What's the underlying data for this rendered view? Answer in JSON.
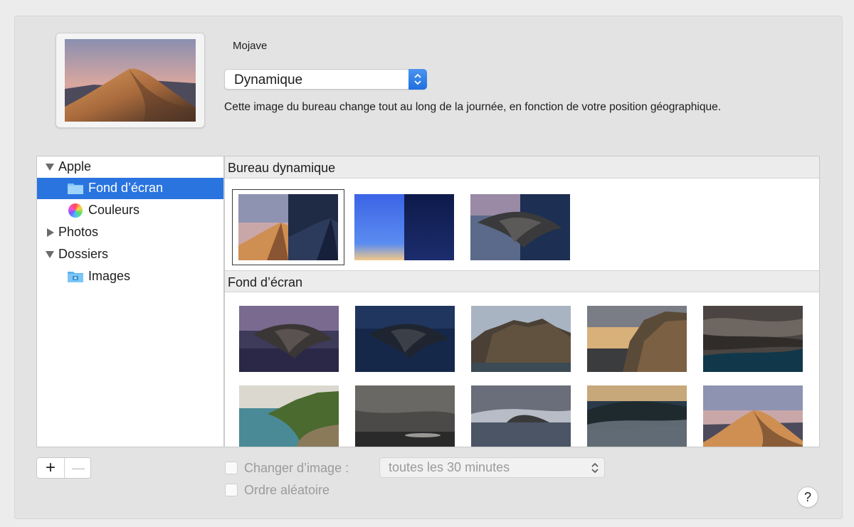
{
  "preview": {
    "wallpaper_name": "Mojave"
  },
  "mode_select": {
    "value": "Dynamique"
  },
  "description": "Cette image du bureau change tout au long de la journée, en fonction de votre position géographique.",
  "sidebar": {
    "items": [
      {
        "label": "Apple",
        "kind": "group-expanded"
      },
      {
        "label": "Fond d’écran",
        "kind": "folder",
        "selected": true
      },
      {
        "label": "Couleurs",
        "kind": "colors"
      },
      {
        "label": "Photos",
        "kind": "group-collapsed"
      },
      {
        "label": "Dossiers",
        "kind": "group-expanded"
      },
      {
        "label": "Images",
        "kind": "pictures-folder"
      }
    ]
  },
  "gallery": {
    "sections": [
      {
        "title": "Bureau dynamique"
      },
      {
        "title": "Fond d’écran"
      }
    ]
  },
  "bottom": {
    "add_label": "+",
    "remove_label": "—",
    "change_picture_label": "Changer d’image :",
    "interval_value": "toutes les 30 minutes",
    "random_order_label": "Ordre aléatoire",
    "help_label": "?"
  },
  "colors": {
    "accent": "#2a74e0"
  }
}
